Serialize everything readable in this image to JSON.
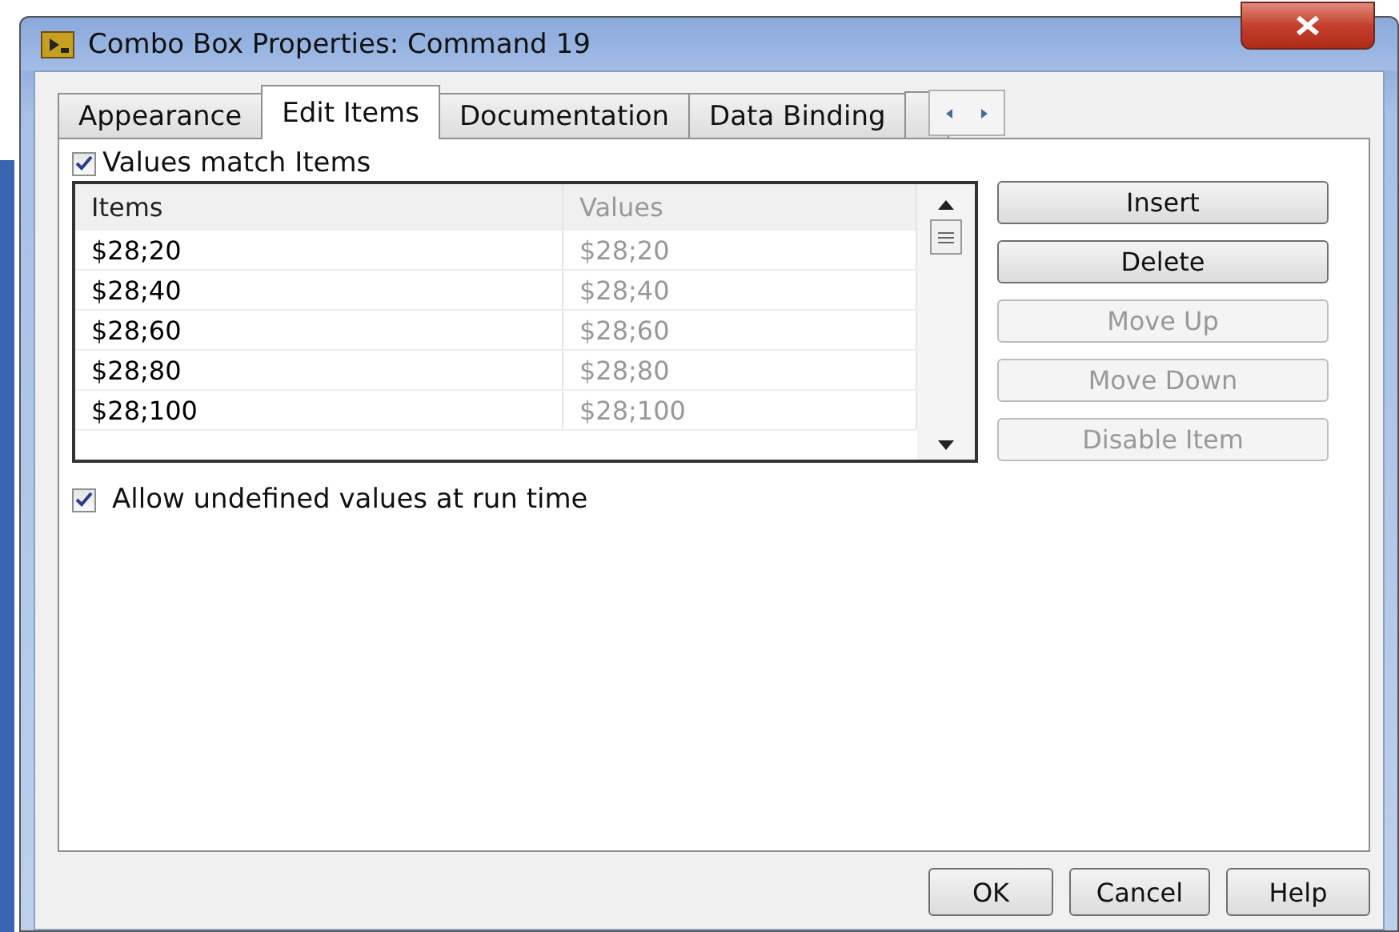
{
  "window": {
    "title": "Combo Box Properties: Command 19"
  },
  "tabs": [
    {
      "label": "Appearance",
      "selected": false
    },
    {
      "label": "Edit Items",
      "selected": true
    },
    {
      "label": "Documentation",
      "selected": false
    },
    {
      "label": "Data Binding",
      "selected": false
    }
  ],
  "values_match_items": {
    "label": "Values match Items",
    "checked": true
  },
  "table": {
    "columns": [
      {
        "label": "Items",
        "disabled": false
      },
      {
        "label": "Values",
        "disabled": true
      }
    ],
    "rows": [
      [
        "$28;20",
        "$28;20"
      ],
      [
        "$28;40",
        "$28;40"
      ],
      [
        "$28;60",
        "$28;60"
      ],
      [
        "$28;80",
        "$28;80"
      ],
      [
        "$28;100",
        "$28;100"
      ]
    ]
  },
  "side_buttons": [
    {
      "label": "Insert",
      "disabled": false
    },
    {
      "label": "Delete",
      "disabled": false
    },
    {
      "label": "Move Up",
      "disabled": true
    },
    {
      "label": "Move Down",
      "disabled": true
    },
    {
      "label": "Disable Item",
      "disabled": true
    }
  ],
  "allow_undefined": {
    "label": "Allow undefined values at run time",
    "checked": true
  },
  "buttons": [
    "OK",
    "Cancel",
    "Help"
  ]
}
